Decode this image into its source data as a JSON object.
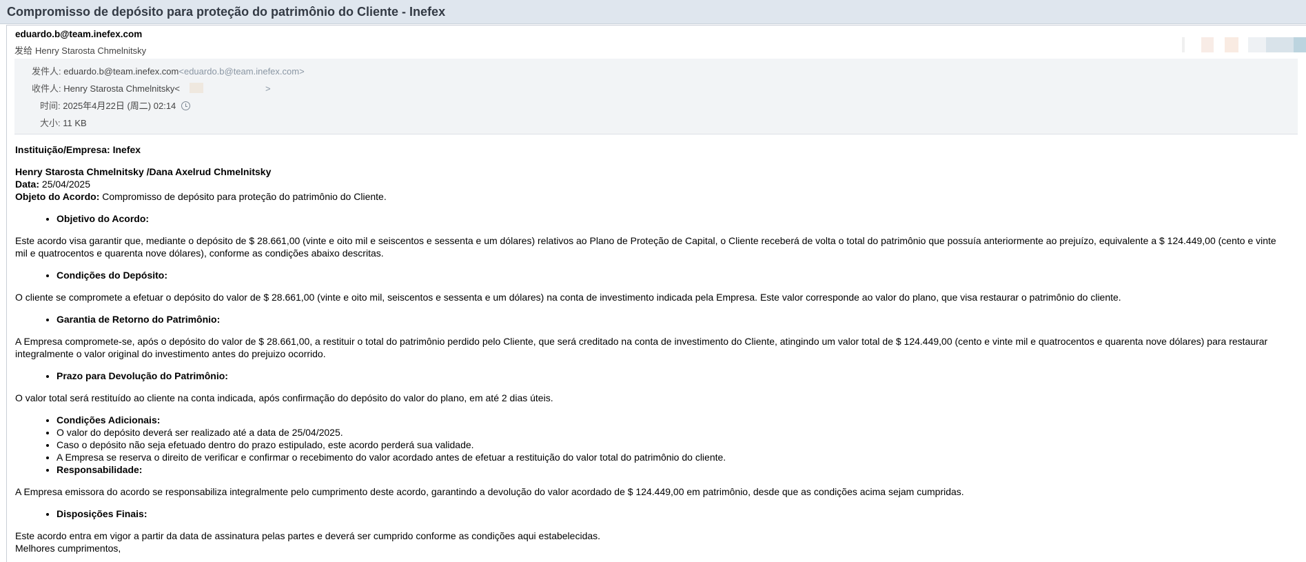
{
  "window": {
    "title": "Compromisso de depósito para proteção do patrimônio do Cliente - Inefex"
  },
  "header": {
    "from_display": "eduardo.b@team.inefex.com",
    "sendto_prefix": "发给",
    "sendto_name": "Henry Starosta Chmelnitsky",
    "from_label": "发件人:",
    "from_value": "eduardo.b@team.inefex.com",
    "from_angle": "<eduardo.b@team.inefex.com>",
    "to_label": "收件人:",
    "to_value": "Henry Starosta Chmelnitsky<",
    "to_close": ">",
    "time_label": "时间:",
    "time_value": "2025年4月22日 (周二) 02:14",
    "size_label": "大小:",
    "size_value": "11 KB"
  },
  "colors": {
    "titlebar_bg": "#dfe6ee",
    "meta_bg": "#f2f4f6",
    "clock_icon": "#7c8793"
  },
  "body": {
    "institution": "Instituição/Empresa: Inefex",
    "names": "Henry Starosta Chmelnitsky /Dana Axelrud Chmelnitsky",
    "date_label": "Data:",
    "date_value": "25/04/2025",
    "object_label": "Objeto do Acordo:",
    "object_value": "Compromisso de depósito para proteção do patrimônio do Cliente.",
    "s1_heading": "Objetivo do Acordo:",
    "s1_text": "Este acordo visa garantir que, mediante o depósito de $ 28.661,00 (vinte e oito mil e seiscentos e sessenta e um dólares) relativos ao Plano de Proteção de Capital, o Cliente receberá de volta o total do patrimônio que possuía anteriormente ao prejuízo, equivalente a $ 124.449,00 (cento e vinte mil e quatrocentos e quarenta nove dólares), conforme as condições abaixo descritas.",
    "s2_heading": "Condições do Depósito:",
    "s2_text": "O cliente se compromete a efetuar o depósito do valor de $ 28.661,00 (vinte e oito mil, seiscentos e sessenta e um dólares) na conta de investimento indicada pela Empresa. Este valor corresponde ao valor do plano, que visa restaurar o patrimônio do cliente.",
    "s3_heading": "Garantia de Retorno do Patrimônio:",
    "s3_text": "A Empresa compromete-se, após o depósito do valor de $ 28.661,00, a restituir o total do patrimônio perdido pelo Cliente, que será creditado na conta de investimento do Cliente, atingindo um valor total de $ 124.449,00 (cento e vinte mil e quatrocentos e quarenta nove dólares) para restaurar integralmente o valor original do investimento antes do prejuizo ocorrido.",
    "s4_heading": "Prazo para Devolução do Patrimônio:",
    "s4_text": "O valor total será restituído ao cliente na conta indicada, após confirmação do depósito do valor do plano, em até 2 dias úteis.",
    "s5_heading": "Condições Adicionais:",
    "s5_items": [
      "O valor do depósito deverá ser realizado até a data de 25/04/2025.",
      "Caso o depósito não seja efetuado dentro do prazo estipulado, este acordo perderá sua validade.",
      "A Empresa se reserva o direito de verificar e confirmar o recebimento do valor acordado antes de efetuar a restituição do valor total do patrimônio do cliente."
    ],
    "s6_heading": "Responsabilidade:",
    "s6_text": "A Empresa emissora do acordo se responsabiliza integralmente pelo cumprimento deste acordo, garantindo a devolução do valor acordado de $ 124.449,00 em patrimônio, desde que as condições acima sejam cumpridas.",
    "s7_heading": "Disposições Finais:",
    "s7_text": "Este acordo entra em vigor a partir da data de assinatura pelas partes e deverá ser cumprido conforme as condições aqui estabelecidas.",
    "closing": "Melhores cumprimentos,"
  }
}
